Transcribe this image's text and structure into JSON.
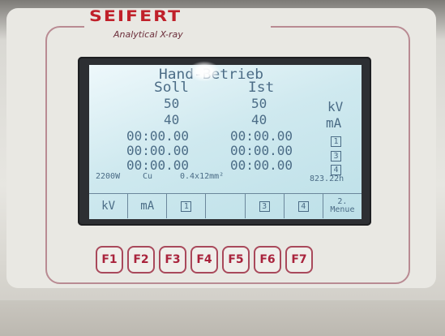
{
  "device": {
    "brand": "SEIFERT",
    "subtitle": "Analytical X-ray"
  },
  "lcd": {
    "mode_title": "Hand-Betrieb",
    "col_soll": "Soll",
    "col_ist": "Ist",
    "kv_soll": "50",
    "kv_ist": "50",
    "kv_unit": "kV",
    "ma_soll": "40",
    "ma_ist": "40",
    "ma_unit": "mA",
    "timers": [
      {
        "soll": "00:00.00",
        "ist": "00:00.00",
        "tag": "1"
      },
      {
        "soll": "00:00.00",
        "ist": "00:00.00",
        "tag": "3"
      },
      {
        "soll": "00:00.00",
        "ist": "00:00.00",
        "tag": "4"
      }
    ],
    "power": "2200W",
    "anode": "Cu",
    "focus": "0.4x12mm²",
    "hours": "823.22h",
    "softkeys": [
      "kV",
      "mA",
      "1",
      "",
      "3",
      "4",
      "2.\nMenue"
    ]
  },
  "function_keys": [
    "F1",
    "F2",
    "F3",
    "F4",
    "F5",
    "F6",
    "F7"
  ]
}
